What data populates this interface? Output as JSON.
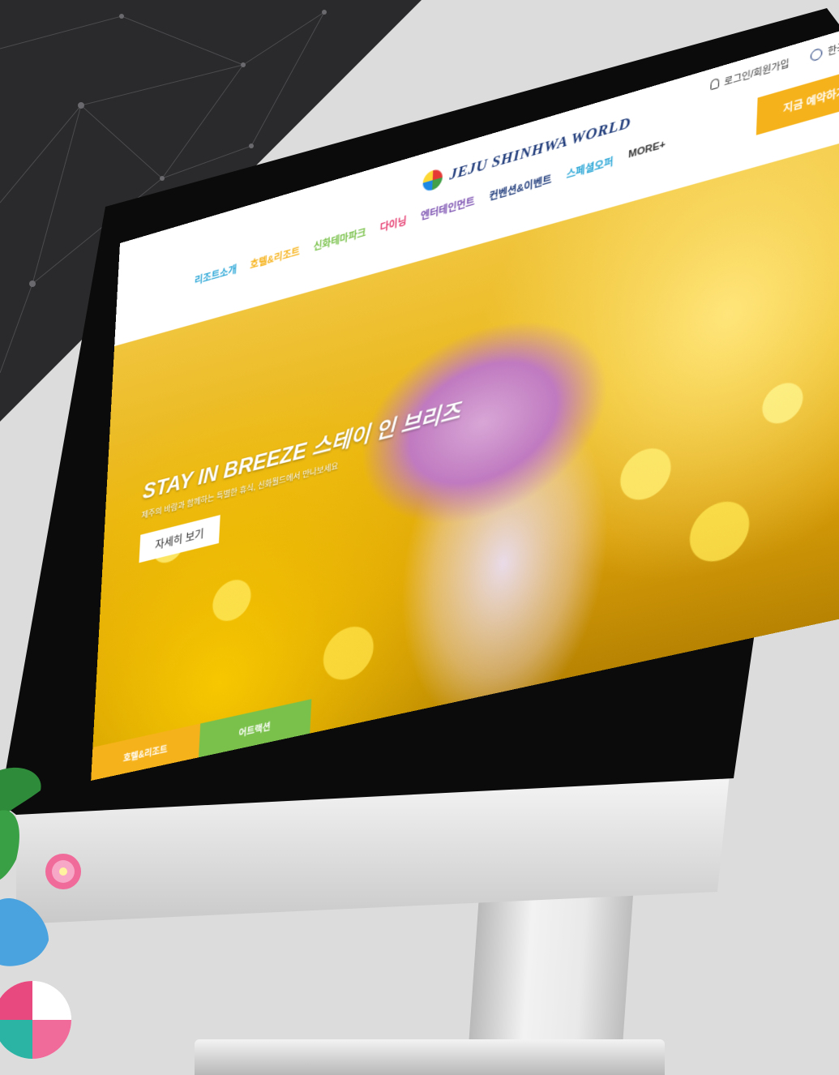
{
  "site": {
    "logo_text": "JEJU SHINHWA WORLD",
    "util": {
      "login_label": "로그인/회원가입",
      "lang_label": "한국어"
    },
    "reserve_label": "지금 예약하기",
    "nav": [
      {
        "label": "리조트소개",
        "color": "#2aa6d6"
      },
      {
        "label": "호텔&리조트",
        "color": "#f6b21a"
      },
      {
        "label": "신화테마파크",
        "color": "#79c14a"
      },
      {
        "label": "다이닝",
        "color": "#e5396e"
      },
      {
        "label": "엔터테인먼트",
        "color": "#7a4fb0"
      },
      {
        "label": "컨벤션&이벤트",
        "color": "#1f3b7a"
      },
      {
        "label": "스페셜오퍼",
        "color": "#2aa6d6"
      },
      {
        "label": "MORE+",
        "color": "#333333"
      }
    ]
  },
  "hero": {
    "title": "STAY IN BREEZE 스테이 인 브리즈",
    "subtitle": "제주의 바람과 함께하는 특별한 휴식, 신화월드에서 만나보세요",
    "detail_label": "자세히 보기"
  },
  "tabs": {
    "hotel_label": "호텔&리조트",
    "attraction_label": "어트랙션"
  },
  "colors": {
    "accent_yellow": "#f6b21a",
    "accent_green": "#79c14a",
    "bezel": "#0b0b0b"
  }
}
